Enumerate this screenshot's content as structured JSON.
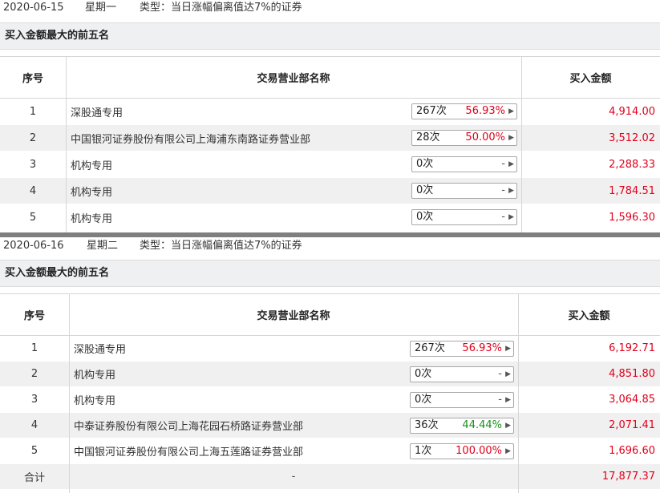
{
  "sections": [
    {
      "date": "2020-06-15",
      "weekday": "星期一",
      "type_label": "类型：当日涨幅偏离值达7%的证券",
      "subtitle": "买入金额最大的前五名",
      "headers": {
        "seq": "序号",
        "name": "交易营业部名称",
        "amount": "买入金额"
      },
      "rows": [
        {
          "seq": "1",
          "name": "深股通专用",
          "count": "267次",
          "pct": "56.93%",
          "pct_color": "red",
          "amount": "4,914.00"
        },
        {
          "seq": "2",
          "name": "中国银河证券股份有限公司上海浦东南路证券营业部",
          "count": "28次",
          "pct": "50.00%",
          "pct_color": "red",
          "amount": "3,512.02"
        },
        {
          "seq": "3",
          "name": "机构专用",
          "count": "0次",
          "pct": "-",
          "pct_color": "grey",
          "amount": "2,288.33"
        },
        {
          "seq": "4",
          "name": "机构专用",
          "count": "0次",
          "pct": "-",
          "pct_color": "grey",
          "amount": "1,784.51"
        },
        {
          "seq": "5",
          "name": "机构专用",
          "count": "0次",
          "pct": "-",
          "pct_color": "grey",
          "amount": "1,596.30"
        }
      ]
    },
    {
      "date": "2020-06-16",
      "weekday": "星期二",
      "type_label": "类型：当日涨幅偏离值达7%的证券",
      "subtitle": "买入金额最大的前五名",
      "headers": {
        "seq": "序号",
        "name": "交易营业部名称",
        "amount": "买入金额"
      },
      "rows": [
        {
          "seq": "1",
          "name": "深股通专用",
          "count": "267次",
          "pct": "56.93%",
          "pct_color": "red",
          "amount": "6,192.71"
        },
        {
          "seq": "2",
          "name": "机构专用",
          "count": "0次",
          "pct": "-",
          "pct_color": "grey",
          "amount": "4,851.80"
        },
        {
          "seq": "3",
          "name": "机构专用",
          "count": "0次",
          "pct": "-",
          "pct_color": "grey",
          "amount": "3,064.85"
        },
        {
          "seq": "4",
          "name": "中泰证券股份有限公司上海花园石桥路证券营业部",
          "count": "36次",
          "pct": "44.44%",
          "pct_color": "green",
          "amount": "2,071.41"
        },
        {
          "seq": "5",
          "name": "中国银河证券股份有限公司上海五莲路证券营业部",
          "count": "1次",
          "pct": "100.00%",
          "pct_color": "red",
          "amount": "1,696.60"
        }
      ],
      "total": {
        "label": "合计",
        "name": "-",
        "amount": "17,877.37"
      }
    }
  ],
  "colors": {
    "amount": "#e0001b",
    "pct_red": "#e0001b",
    "pct_green": "#1a8f1a",
    "row_alt": "#f0f0f0",
    "subhead_bg": "#eef0f2",
    "divider": "#7f7f7f"
  },
  "icons": {
    "pill_arrow": "triangle-right-icon"
  }
}
